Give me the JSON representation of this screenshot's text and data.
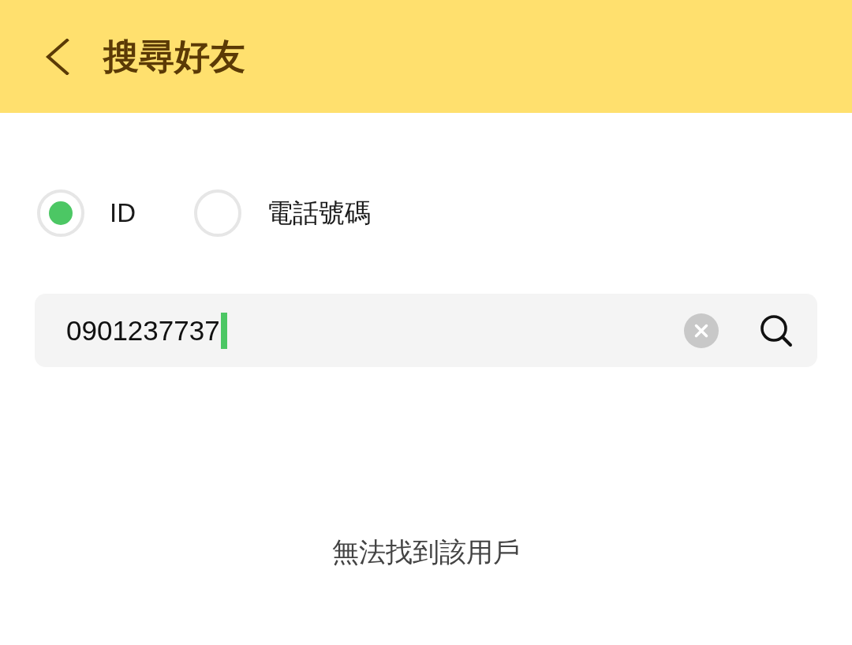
{
  "header": {
    "title": "搜尋好友"
  },
  "search_types": [
    {
      "label": "ID",
      "selected": true
    },
    {
      "label": "電話號碼",
      "selected": false
    }
  ],
  "search": {
    "value": "0901237737",
    "focused": true
  },
  "message": "無法找到該用戶"
}
